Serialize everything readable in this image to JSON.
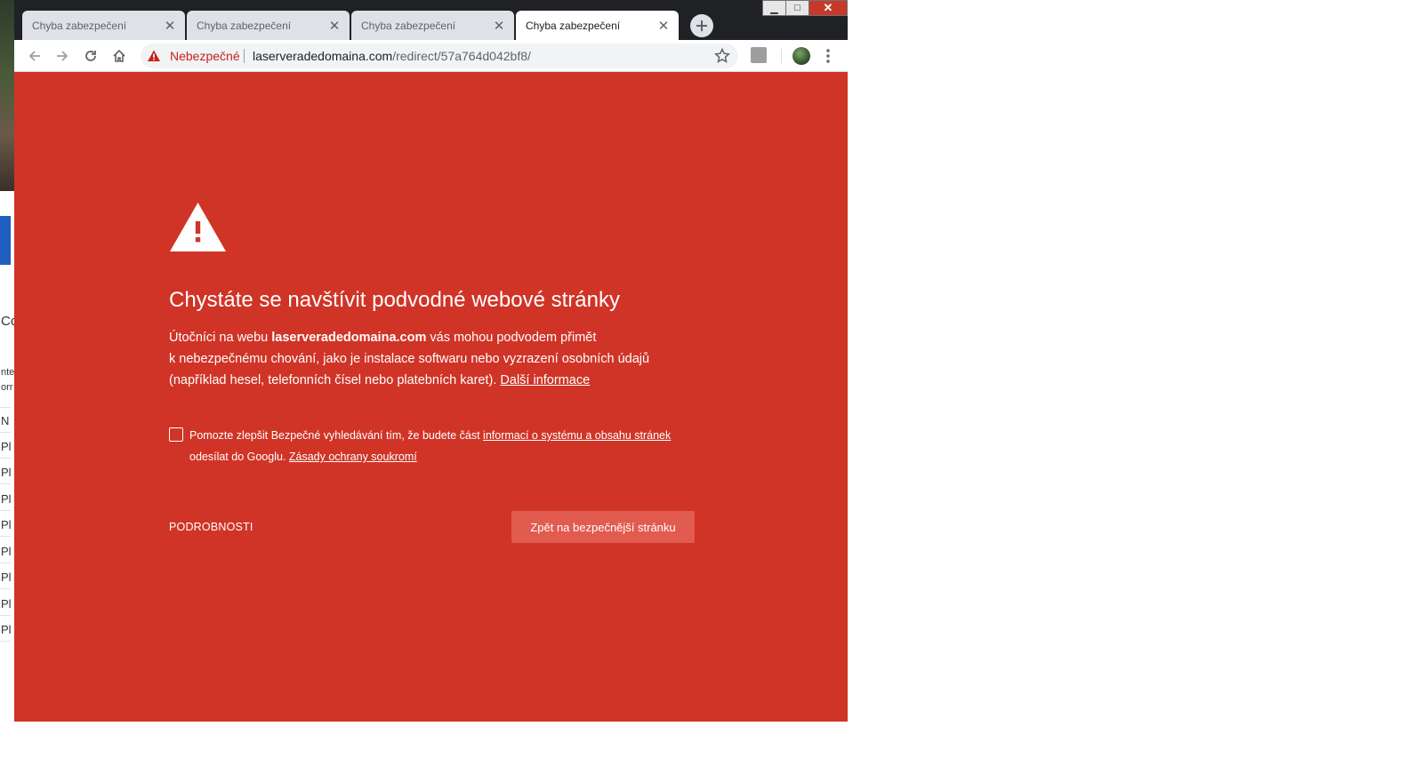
{
  "background_app": {
    "letters": [
      "Co",
      "nte",
      "orr",
      "N",
      "Pl",
      "Pl",
      "Pl",
      "Pl",
      "Pl",
      "Pl",
      "Pl",
      "Pl"
    ]
  },
  "window_controls": {
    "minimize": "▁",
    "maximize": "□",
    "close": "✕"
  },
  "tabs": [
    {
      "title": "Chyba zabezpečení",
      "active": false
    },
    {
      "title": "Chyba zabezpečení",
      "active": false
    },
    {
      "title": "Chyba zabezpečení",
      "active": false
    },
    {
      "title": "Chyba zabezpečení",
      "active": true
    }
  ],
  "tab_close_glyph": "✕",
  "toolbar": {
    "icons": [
      "back-arrow-icon",
      "forward-arrow-icon",
      "reload-icon",
      "home-icon",
      "star-icon",
      "pdf-extension-icon",
      "avatar",
      "menu-dots-icon"
    ]
  },
  "omnibox": {
    "status": "Nebezpečné",
    "url_host": "laserveradedomaina.com",
    "url_path": "/redirect/57a764d042bf8/"
  },
  "page": {
    "heading": "Chystáte se navštívit podvodné webové stránky",
    "explanation": {
      "prefix": "Útočníci na webu ",
      "host": "laserveradedomaina.com",
      "line1_suffix": " vás mohou podvodem přimět",
      "line2": "k nebezpečnému chování, jako je instalace softwaru nebo vyzrazení osobních údajů",
      "line3": "(například hesel, telefonních čísel nebo platebních karet). ",
      "learn_more": "Další informace"
    },
    "optin": {
      "prefix": "Pomozte zlepšit Bezpečné vyhledávání tím, že budete část ",
      "link": "informací o systému a obsahu stránek",
      "line2": "odesílat do Googlu. ",
      "privacy_link": "Zásady ochrany soukromí",
      "checked": false
    },
    "details_label": "PODROBNOSTI",
    "primary_button": "Zpět na bezpečnější stránku"
  },
  "colors": {
    "interstitial_bg": "#d03427",
    "primary_button_bg": "#e25b4f",
    "tabstrip_bg": "#202124",
    "danger_text": "#c5221f"
  }
}
